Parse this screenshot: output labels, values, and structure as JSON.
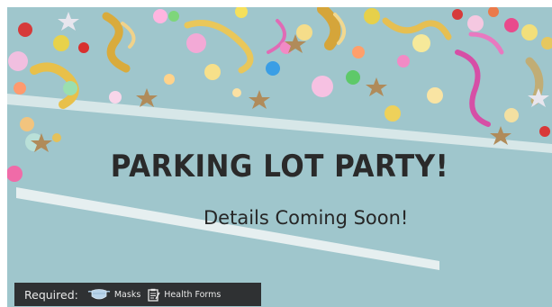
{
  "banner": {
    "headline": "PARKING LOT PARTY!",
    "subline": "Details Coming Soon!"
  },
  "requirements": {
    "label": "Required:",
    "items": [
      {
        "icon": "mask-icon",
        "label": "Masks"
      },
      {
        "icon": "clipboard-form-icon",
        "label": "Health Forms"
      }
    ]
  },
  "colors": {
    "background": "#9fc6cc",
    "bar": "#2f3133",
    "text": "#2a2a2a"
  }
}
